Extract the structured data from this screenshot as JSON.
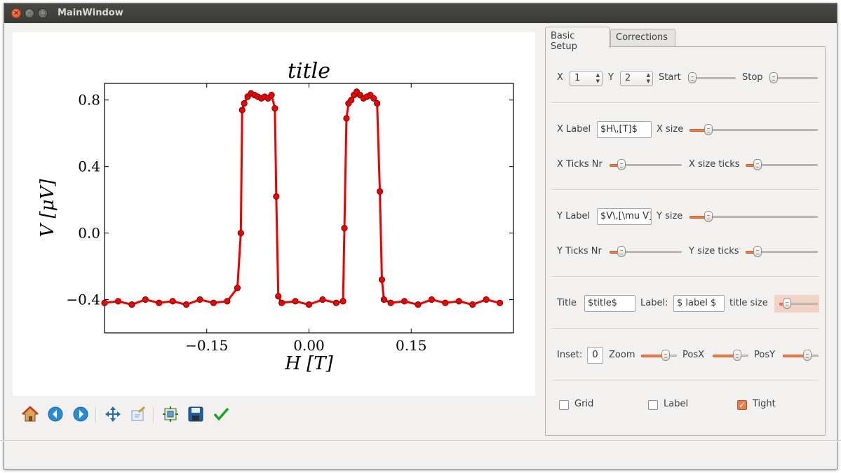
{
  "window": {
    "title": "MainWindow"
  },
  "plot": {
    "title": "title",
    "xlabel": "H [T]",
    "ylabel": "V [μV]",
    "color": "#ee0000",
    "chart_data": {
      "type": "scatter",
      "title": "title",
      "xlabel": "H [T]",
      "ylabel": "V [μV]",
      "xlim": [
        -0.3,
        0.3
      ],
      "ylim": [
        -0.6,
        0.9
      ],
      "xticks": [
        -0.15,
        0.0,
        0.15
      ],
      "xtick_labels": [
        "−0.15",
        "0.00",
        "0.15"
      ],
      "yticks": [
        -0.4,
        0.0,
        0.4,
        0.8
      ],
      "ytick_labels": [
        "−0.4",
        "0.0",
        "0.4",
        "0.8"
      ],
      "grid": false,
      "series": [
        {
          "x": [
            -0.3,
            -0.28,
            -0.26,
            -0.24,
            -0.22,
            -0.2,
            -0.18,
            -0.16,
            -0.14,
            -0.12,
            -0.105,
            -0.1,
            -0.098,
            -0.095,
            -0.09,
            -0.085,
            -0.08,
            -0.075,
            -0.07,
            -0.065,
            -0.06,
            -0.055,
            -0.05,
            -0.048,
            -0.045,
            -0.04,
            -0.02,
            0.0,
            0.02,
            0.04,
            0.05,
            0.052,
            0.055,
            0.058,
            0.062,
            0.066,
            0.07,
            0.075,
            0.08,
            0.085,
            0.09,
            0.095,
            0.1,
            0.104,
            0.107,
            0.11,
            0.12,
            0.14,
            0.16,
            0.18,
            0.2,
            0.22,
            0.24,
            0.26,
            0.28
          ],
          "y": [
            -0.42,
            -0.41,
            -0.43,
            -0.4,
            -0.42,
            -0.41,
            -0.43,
            -0.4,
            -0.42,
            -0.41,
            -0.33,
            0.0,
            0.74,
            0.78,
            0.82,
            0.84,
            0.83,
            0.82,
            0.81,
            0.82,
            0.81,
            0.83,
            0.75,
            0.22,
            -0.38,
            -0.42,
            -0.41,
            -0.43,
            -0.4,
            -0.42,
            -0.41,
            0.03,
            0.69,
            0.78,
            0.8,
            0.83,
            0.85,
            0.83,
            0.81,
            0.82,
            0.83,
            0.81,
            0.78,
            0.25,
            -0.28,
            -0.4,
            -0.42,
            -0.41,
            -0.43,
            -0.4,
            -0.42,
            -0.41,
            -0.43,
            -0.4,
            -0.42
          ]
        }
      ]
    }
  },
  "toolbar": {
    "items": [
      "home-icon",
      "back-icon",
      "forward-icon",
      "pan-icon",
      "zoom-icon",
      "configure-subplots-icon",
      "save-icon",
      "apply-icon"
    ]
  },
  "tabs": {
    "basic": "Basic Setup",
    "corrections": "Corrections"
  },
  "basic": {
    "x_label": "X",
    "x_value": "1",
    "y_label": "Y",
    "y_value": "2",
    "start_label": "Start",
    "stop_label": "Stop",
    "xlabel_label": "X Label",
    "xlabel_value": "$H\\,[T]$",
    "xsize_label": "X size",
    "xticks_label": "X Ticks Nr",
    "xsizeticks_label": "X size ticks",
    "ylabel_label": "Y Label",
    "ylabel_value": "$V\\,[\\mu V]$",
    "ysize_label": "Y size",
    "yticks_label": "Y Ticks Nr",
    "ysizeticks_label": "Y size ticks",
    "title_label": "Title",
    "title_value": "$title$",
    "label_label": "Label:",
    "label_value": "$ label $",
    "titlesize_label": "title size",
    "inset_label": "Inset:",
    "inset_value": "0",
    "zoom_label": "Zoom",
    "posx_label": "PosX",
    "posy_label": "PosY",
    "grid_label": "Grid",
    "grid_checked": false,
    "label_cb_label": "Label",
    "label_checked": false,
    "tight_label": "Tight",
    "tight_checked": true
  },
  "sliders": {
    "start": 0.0,
    "stop": 0.0,
    "xsize": 0.12,
    "xticks": 0.12,
    "xsizeticks": 0.12,
    "ysize": 0.12,
    "yticks": 0.12,
    "ysizeticks": 0.12,
    "titlesize": 0.12,
    "zoom": 0.75,
    "posx": 0.75,
    "posy": 0.75
  },
  "colors": {
    "accent": "#e97f4c",
    "plot_red": "#ee0000"
  }
}
